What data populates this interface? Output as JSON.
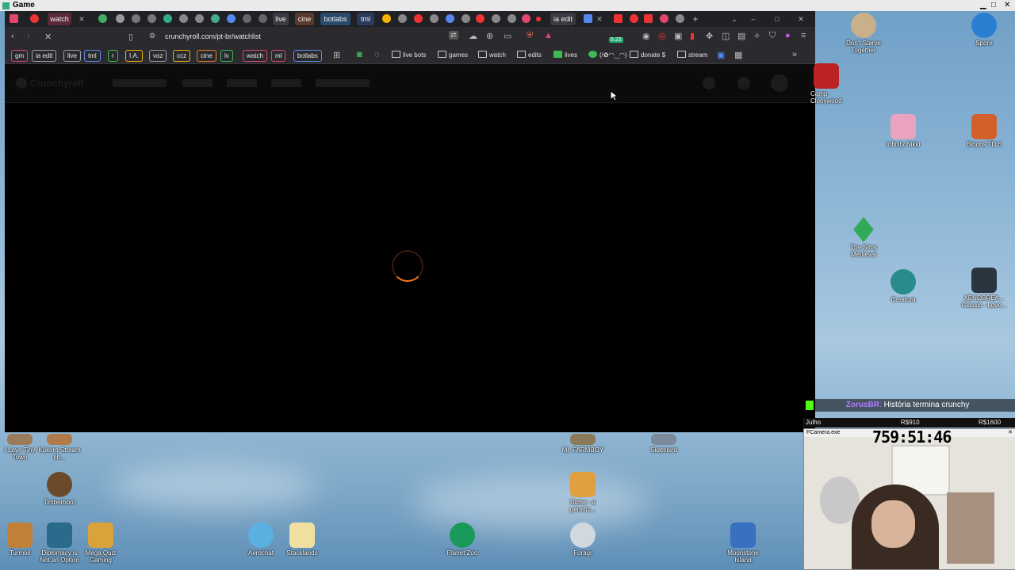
{
  "os": {
    "window_title": "Game"
  },
  "tabs": [
    "watch",
    "live",
    "cine",
    "botlabs",
    "tml",
    "ia edit"
  ],
  "address": {
    "url": "crunchyroll.com/pt-br/watchlist",
    "badge": "5.22"
  },
  "bookmarks": {
    "tags": [
      {
        "label": "gm",
        "color": "#e0476f"
      },
      {
        "label": "ia edit",
        "color": "#9aa0a6"
      },
      {
        "label": "live",
        "color": "#9aa0a6"
      },
      {
        "label": "tml",
        "color": "#5a8dee"
      },
      {
        "label": "r",
        "color": "#3cba54"
      },
      {
        "label": "I.A.",
        "color": "#f4b400"
      },
      {
        "label": "voz",
        "color": "#9aa0a6"
      },
      {
        "label": "ccz",
        "color": "#f4b400"
      },
      {
        "label": "cine",
        "color": "#e67e22"
      },
      {
        "label": "lv",
        "color": "#3cba54"
      },
      {
        "label": "watch",
        "color": "#e0476f"
      },
      {
        "label": "ml",
        "color": "#e0476f"
      },
      {
        "label": "botlabs",
        "color": "#5a8dee"
      }
    ],
    "folders": [
      "live bots",
      "games",
      "watch",
      "edits",
      "lives",
      "(/✿◠‿◠)",
      "donate $",
      "stream"
    ]
  },
  "page": {
    "brand": "Crunchyroll"
  },
  "desktop": {
    "right_icons": [
      "Don't Starve Together",
      "Spore",
      "Camp Clonywood",
      "Infinity Nikki",
      "Bloons TD 6",
      "The Sims Medieval",
      "Creatura",
      "XENOBREA... Classic - Love..."
    ],
    "bottom_icons": [
      "Timberborn",
      "Turmoil",
      "Diplomacy is Not an Option",
      "Mega Quiz Gaming",
      "Aerochat",
      "Stacklands",
      "Planet Zoo",
      "Foragr",
      "Moonstone Island",
      "Niche - a genetic...",
      "Mr. FARMBOY",
      "Skatebird",
      "I Love Tiny Town",
      "Kukoro Stream ch..."
    ]
  },
  "stream": {
    "chat_user": "ZorusBR",
    "chat_text": "História termina crunchy",
    "stat_name": "Julho",
    "stat_1": "R$910",
    "stat_2": "R$1600",
    "cam_title": "FCamera.exe",
    "timer": "759:51:46"
  }
}
